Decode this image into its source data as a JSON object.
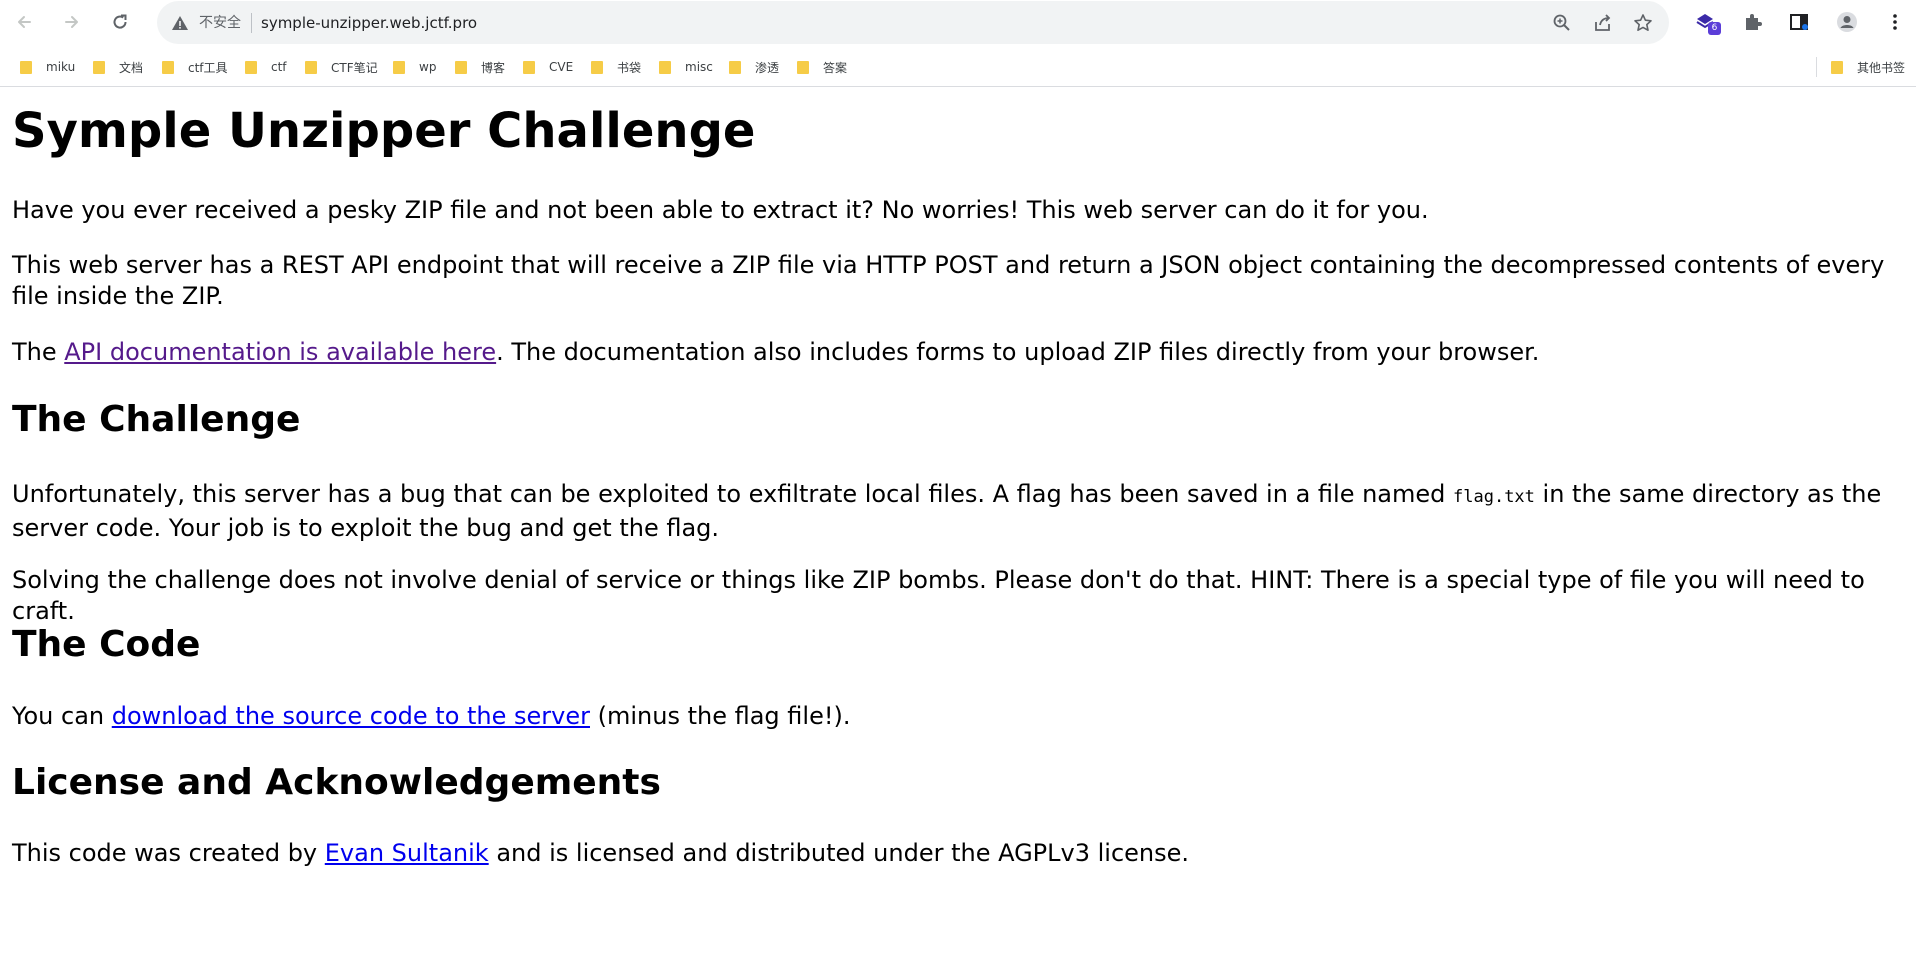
{
  "browser": {
    "address_bar": {
      "security_label": "不安全",
      "url": "symple-unzipper.web.jctf.pro"
    },
    "extension_badge": "6",
    "bookmarks": [
      {
        "label": "miku"
      },
      {
        "label": "文档"
      },
      {
        "label": "ctf工具"
      },
      {
        "label": "ctf"
      },
      {
        "label": "CTF笔记"
      },
      {
        "label": "wp"
      },
      {
        "label": "博客"
      },
      {
        "label": "CVE"
      },
      {
        "label": "书袋"
      },
      {
        "label": "misc"
      },
      {
        "label": "渗透"
      },
      {
        "label": "答案"
      }
    ],
    "other_bookmarks": "其他书签"
  },
  "page": {
    "title": "Symple Unzipper Challenge",
    "intro_1": "Have you ever received a pesky ZIP file and not been able to extract it? No worries! This web server can do it for you.",
    "intro_2": "This web server has a REST API endpoint that will receive a ZIP file via HTTP POST and return a JSON object containing the decompressed contents of every file inside the ZIP.",
    "intro_3_prefix": "The ",
    "intro_3_link": "API documentation is available here",
    "intro_3_suffix": ". The documentation also includes forms to upload ZIP files directly from your browser.",
    "challenge_heading": "The Challenge",
    "challenge_1_prefix": "Unfortunately, this server has a bug that can be exploited to exfiltrate local files. A flag has been saved in a file named ",
    "challenge_1_code": "flag.txt",
    "challenge_1_suffix": " in the same directory as the server code. Your job is to exploit the bug and get the flag.",
    "challenge_2": "Solving the challenge does not involve denial of service or things like ZIP bombs. Please don't do that. HINT: There is a special type of file you will need to craft.",
    "code_heading": "The Code",
    "code_prefix": "You can ",
    "code_link": "download the source code to the server",
    "code_suffix": " (minus the flag file!).",
    "license_heading": "License and Acknowledgements",
    "license_prefix": "This code was created by ",
    "license_link": "Evan Sultanik",
    "license_suffix": " and is licensed and distributed under the AGPLv3 license."
  }
}
